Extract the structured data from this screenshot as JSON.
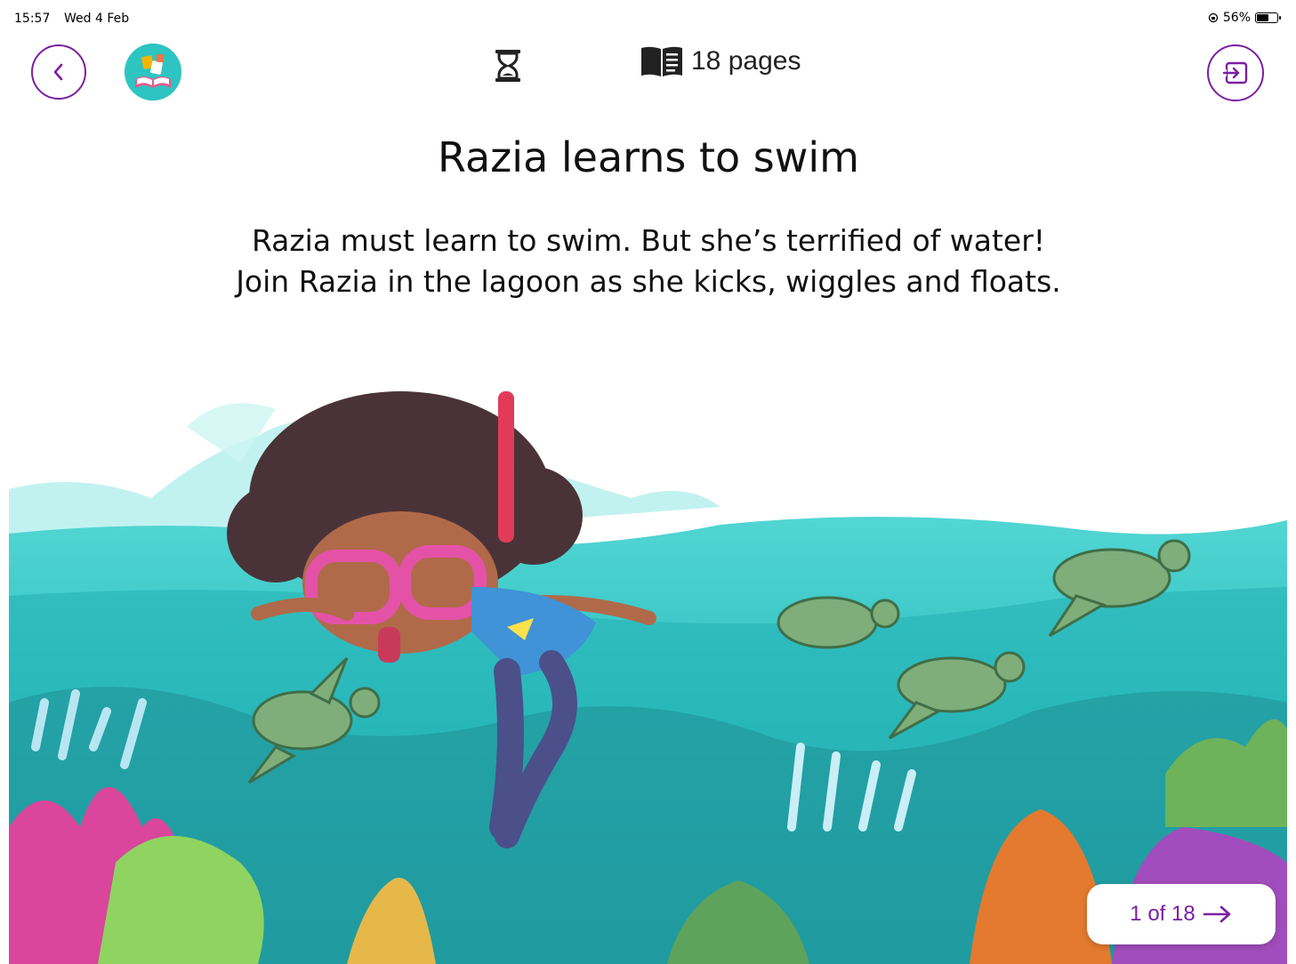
{
  "status_bar": {
    "time": "15:57",
    "date": "Wed 4 Feb",
    "battery": "56%"
  },
  "header": {
    "pages_label": "18 pages",
    "back_icon": "chevron-left-icon",
    "exit_icon": "exit-icon",
    "timer_icon": "hourglass-icon",
    "book_icon": "open-book-icon"
  },
  "book": {
    "title": "Razia learns to swim",
    "description_line1": "Razia must learn to swim. But she’s terrified of water!",
    "description_line2": "Join Razia in the lagoon as she kicks, wiggles and floats."
  },
  "pagination": {
    "label": "1 of 18",
    "current": 1,
    "total": 18
  },
  "colors": {
    "accent": "#7b1fa2",
    "water": "#2fc6c4",
    "deep_water": "#1aa8a8"
  }
}
